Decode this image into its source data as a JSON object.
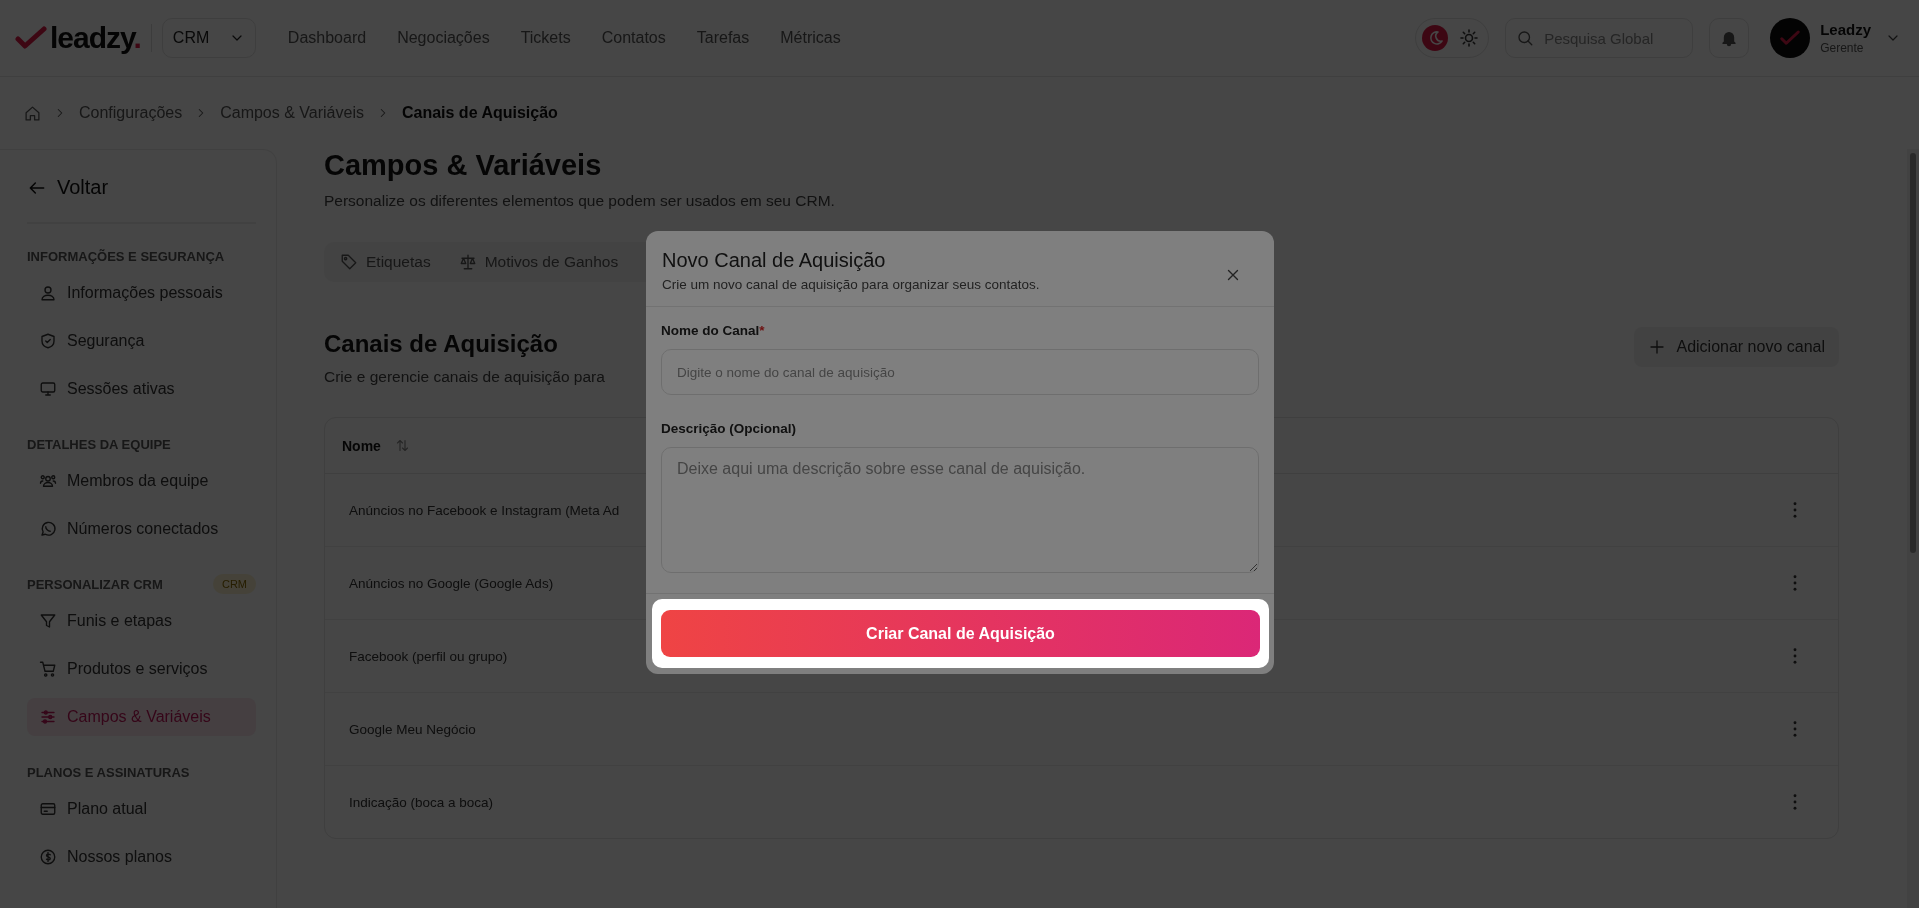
{
  "header": {
    "logo": {
      "text": "leadzy",
      "dot": "."
    },
    "workspace": "CRM",
    "nav": [
      {
        "label": "Dashboard",
        "selected": false
      },
      {
        "label": "Negociações",
        "selected": false
      },
      {
        "label": "Tickets",
        "selected": false
      },
      {
        "label": "Contatos",
        "selected": false
      },
      {
        "label": "Tarefas",
        "selected": false
      },
      {
        "label": "Métricas",
        "selected": false
      }
    ],
    "theme": [
      {
        "kind": "moon",
        "selected": true
      },
      {
        "kind": "sun",
        "selected": false
      }
    ],
    "search": {
      "placeholder": "Pesquisa Global"
    },
    "user": {
      "name": "Leadzy",
      "role": "Gerente"
    }
  },
  "breadcrumb": [
    "Configurações",
    "Campos & Variáveis",
    "Canais de Aquisição"
  ],
  "sidebar": {
    "back": "Voltar",
    "sections": [
      {
        "title": "INFORMAÇÕES E SEGURANÇA",
        "items": [
          {
            "label": "Informações pessoais",
            "selected": false
          },
          {
            "label": "Segurança",
            "selected": false
          },
          {
            "label": "Sessões ativas",
            "selected": false
          }
        ]
      },
      {
        "title": "DETALHES DA EQUIPE",
        "items": [
          {
            "label": "Membros da equipe",
            "selected": false
          },
          {
            "label": "Números conectados",
            "selected": false
          }
        ]
      },
      {
        "title": "PERSONALIZAR CRM",
        "badge": "CRM",
        "items": [
          {
            "label": "Funis e etapas",
            "selected": false
          },
          {
            "label": "Produtos e serviços",
            "selected": false
          },
          {
            "label": "Campos & Variáveis",
            "selected": true
          }
        ]
      },
      {
        "title": "PLANOS E ASSINATURAS",
        "items": [
          {
            "label": "Plano atual",
            "selected": false
          },
          {
            "label": "Nossos planos",
            "selected": false
          }
        ]
      }
    ]
  },
  "page": {
    "title": "Campos & Variáveis",
    "subtitle": "Personalize os diferentes elementos que podem ser usados em seu CRM.",
    "tabs": [
      {
        "label": "Etiquetas"
      },
      {
        "label": "Motivos de Ganhos"
      }
    ],
    "section": {
      "title": "Canais de Aquisição",
      "subtitle": "Crie e gerencie canais de aquisição para",
      "add_button": "Adicionar novo canal"
    },
    "table": {
      "columns": [
        "Nome"
      ],
      "rows": [
        {
          "name": "Anúncios no Facebook e Instagram (Meta Ad"
        },
        {
          "name": "Anúncios no Google (Google Ads)"
        },
        {
          "name": "Facebook (perfil ou grupo)"
        },
        {
          "name": "Google Meu Negócio"
        },
        {
          "name": "Indicação (boca a boca)"
        }
      ]
    }
  },
  "modal": {
    "title": "Novo Canal de Aquisição",
    "subtitle": "Crie um novo canal de aquisição para organizar seus contatos.",
    "fields": [
      {
        "kind": "input",
        "label": "Nome do Canal",
        "required_mark": "*",
        "placeholder": "Digite o nome do canal de aquisição"
      },
      {
        "kind": "textarea",
        "label": "Descrição (Opcional)",
        "placeholder": "Deixe aqui uma descrição sobre esse canal de aquisição."
      }
    ],
    "submit": "Criar Canal de Aquisição"
  }
}
